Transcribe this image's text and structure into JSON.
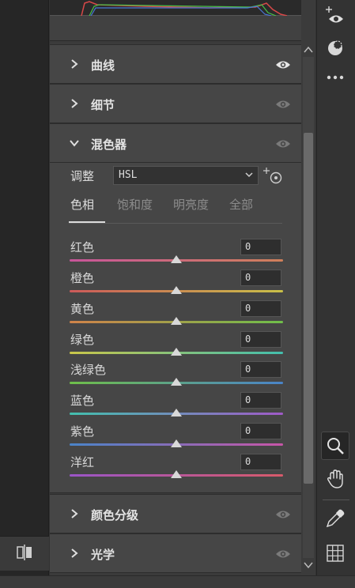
{
  "sections": {
    "curves": {
      "title": "曲线",
      "expanded": false,
      "visibility_icon": "eye-icon"
    },
    "detail": {
      "title": "细节",
      "expanded": false,
      "visibility_icon": "eye-icon"
    },
    "mixer": {
      "title": "混色器",
      "expanded": true,
      "visibility_icon": "eye-icon"
    },
    "color_grading": {
      "title": "颜色分级",
      "expanded": false,
      "visibility_icon": "eye-icon"
    },
    "optics": {
      "title": "光学",
      "expanded": false,
      "visibility_icon": "eye-icon"
    }
  },
  "mixer": {
    "adjust_label": "调整",
    "adjust_value": "HSL",
    "tabs": [
      {
        "label": "色相",
        "active": true
      },
      {
        "label": "饱和度",
        "active": false
      },
      {
        "label": "明亮度",
        "active": false
      },
      {
        "label": "全部",
        "active": false
      }
    ],
    "sliders": [
      {
        "label": "红色",
        "value": "0",
        "gradient": [
          "#c8559a",
          "#d0805a"
        ]
      },
      {
        "label": "橙色",
        "value": "0",
        "gradient": [
          "#cc5a5a",
          "#c9c048"
        ]
      },
      {
        "label": "黄色",
        "value": "0",
        "gradient": [
          "#d0834a",
          "#6fbf4a"
        ]
      },
      {
        "label": "绿色",
        "value": "0",
        "gradient": [
          "#c9c64a",
          "#43bfae"
        ]
      },
      {
        "label": "浅绿色",
        "value": "0",
        "gradient": [
          "#6fbf4a",
          "#4a84c9"
        ]
      },
      {
        "label": "蓝色",
        "value": "0",
        "gradient": [
          "#43bfae",
          "#a05ac8"
        ]
      },
      {
        "label": "紫色",
        "value": "0",
        "gradient": [
          "#4a84c9",
          "#c855a8"
        ]
      },
      {
        "label": "洋红",
        "value": "0",
        "gradient": [
          "#9a55c8",
          "#d85a6a"
        ]
      }
    ]
  },
  "tools": [
    "eye-add-icon",
    "heal-icon",
    "more-icon",
    "zoom-icon",
    "hand-icon",
    "eyedropper-icon",
    "grid-icon"
  ],
  "colors": {
    "panel": "#464646",
    "background": "#3b3b3b",
    "accent_text": "#e2e2e2"
  }
}
